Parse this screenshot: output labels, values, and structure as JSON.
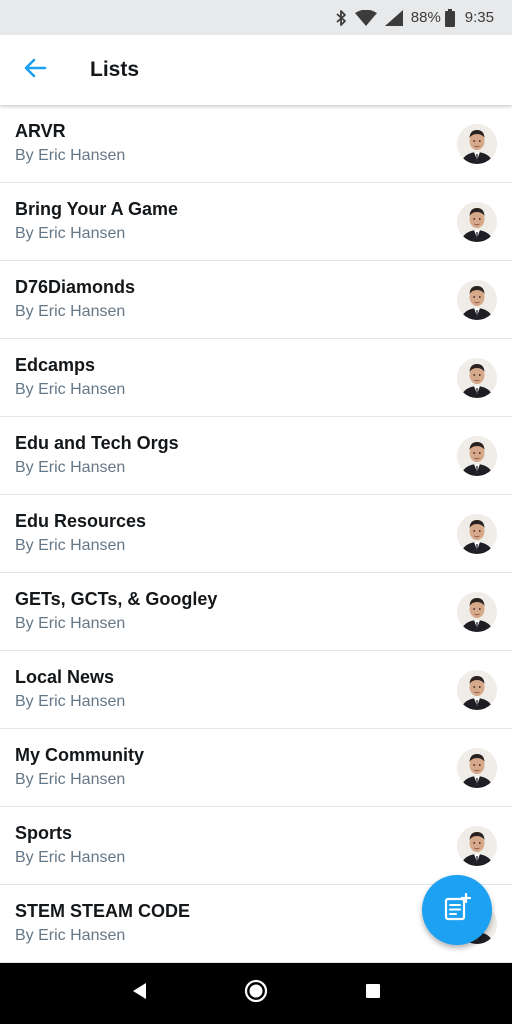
{
  "status_bar": {
    "battery": "88%",
    "time": "9:35",
    "icons": [
      "bluetooth-icon",
      "wifi-icon",
      "signal-icon",
      "battery-icon"
    ]
  },
  "header": {
    "title": "Lists",
    "back_icon": "arrow-left-icon"
  },
  "lists": [
    {
      "title": "ARVR",
      "owner": "By Eric Hansen"
    },
    {
      "title": "Bring Your A Game",
      "owner": "By Eric Hansen"
    },
    {
      "title": "D76Diamonds",
      "owner": "By Eric Hansen"
    },
    {
      "title": "Edcamps",
      "owner": "By Eric Hansen"
    },
    {
      "title": "Edu and Tech Orgs",
      "owner": "By Eric Hansen"
    },
    {
      "title": "Edu Resources",
      "owner": "By Eric Hansen"
    },
    {
      "title": "GETs, GCTs, & Googley",
      "owner": "By Eric Hansen"
    },
    {
      "title": "Local News",
      "owner": "By Eric Hansen"
    },
    {
      "title": "My Community",
      "owner": "By Eric Hansen"
    },
    {
      "title": "Sports",
      "owner": "By Eric Hansen"
    },
    {
      "title": "STEM STEAM CODE",
      "owner": "By Eric Hansen"
    }
  ],
  "fab": {
    "icon": "new-list-icon"
  },
  "nav_bar": {
    "icons": [
      "back-triangle-icon",
      "home-circle-icon",
      "recents-square-icon"
    ]
  },
  "colors": {
    "accent": "#1da1f2",
    "title_text": "#14171a",
    "secondary_text": "#657786",
    "divider": "#e1e8ed",
    "status_bar_bg": "#e8e9ea"
  }
}
